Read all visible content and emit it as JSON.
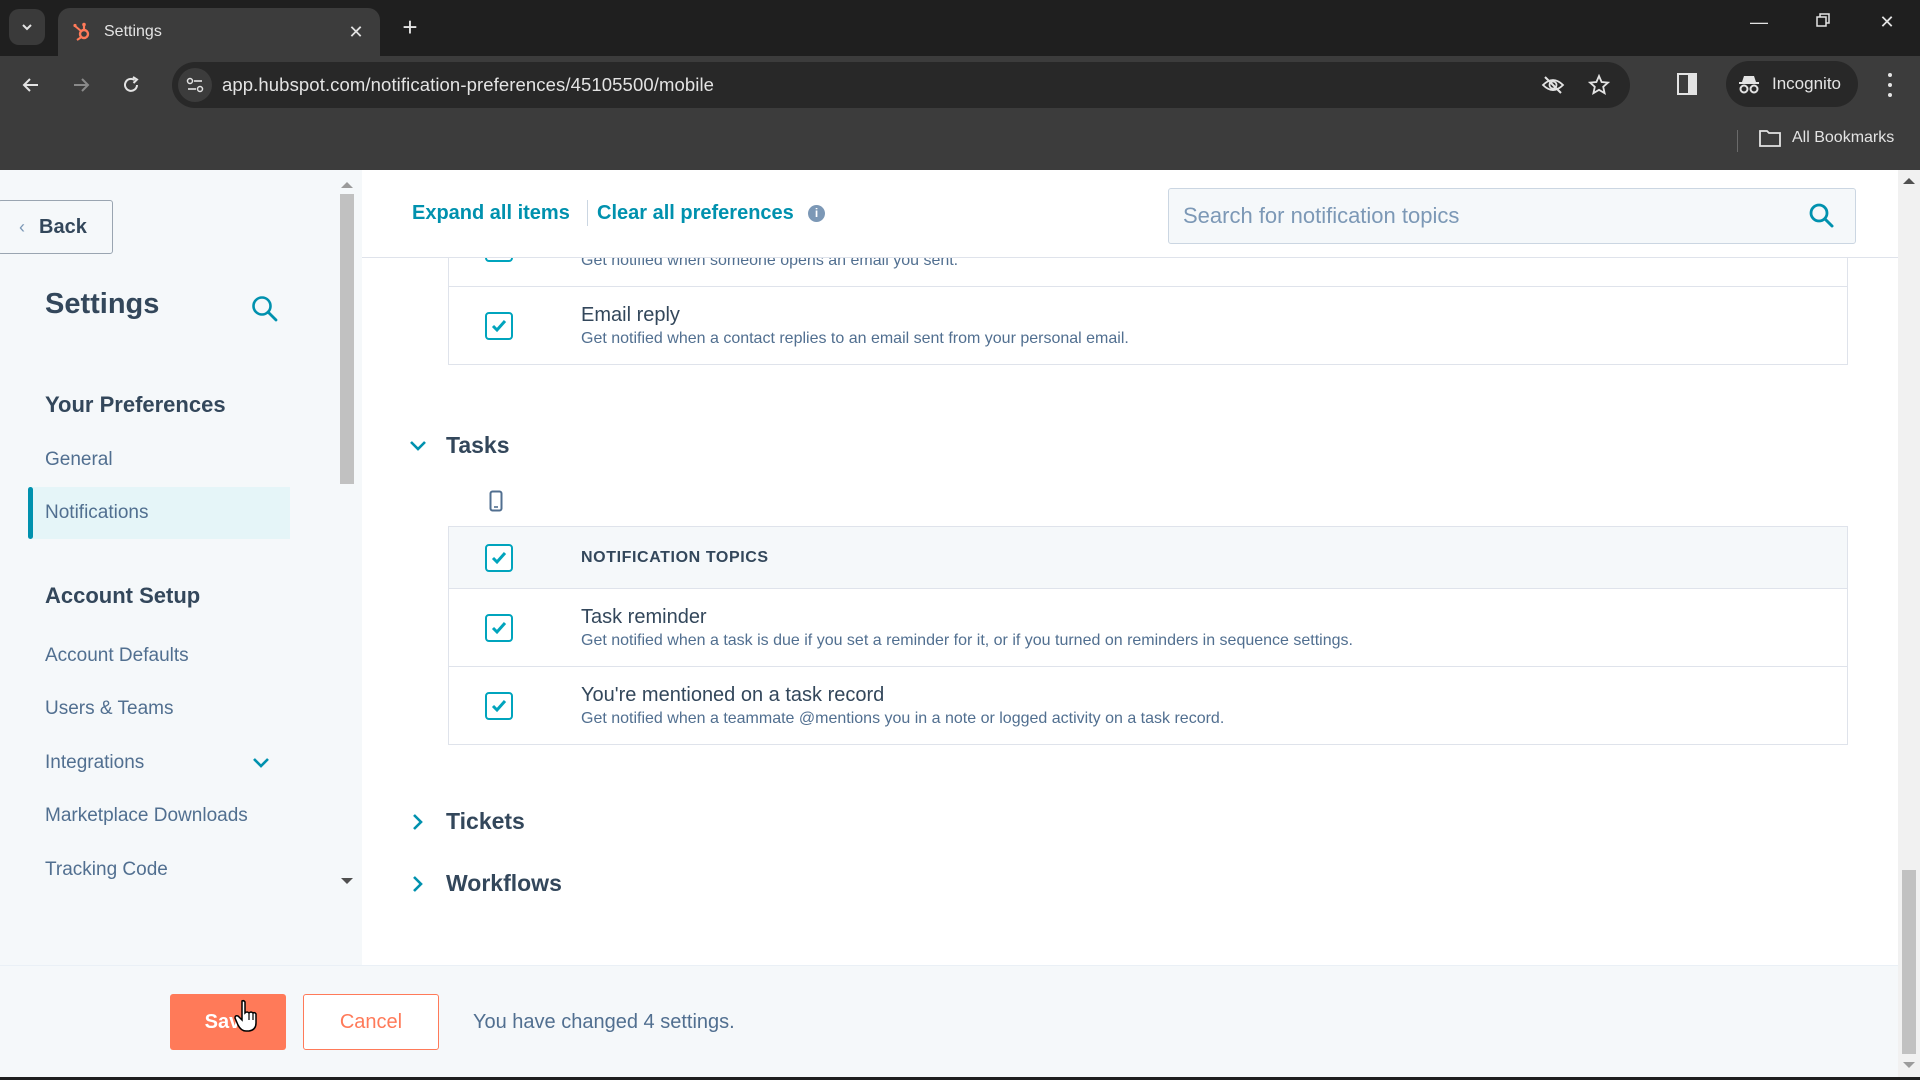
{
  "browser": {
    "tab": {
      "title": "Settings",
      "favicon": "hubspot-sprocket-icon"
    },
    "url": "app.hubspot.com/notification-preferences/45105500/mobile",
    "profile_label": "Incognito",
    "bookmarks_label": "All Bookmarks",
    "icons": [
      "tab-search-icon",
      "close-icon",
      "plus-icon",
      "minimize-icon",
      "restore-icon",
      "window-close-icon",
      "back-arrow-icon",
      "forward-arrow-icon",
      "reload-icon",
      "site-info-icon",
      "eye-off-icon",
      "star-icon",
      "side-panel-icon",
      "incognito-icon",
      "more-vert-icon",
      "folder-icon"
    ]
  },
  "sidebar": {
    "back_label": "Back",
    "title": "Settings",
    "sections": [
      {
        "heading": "Your Preferences",
        "items": [
          {
            "label": "General",
            "active": false
          },
          {
            "label": "Notifications",
            "active": true
          }
        ]
      },
      {
        "heading": "Account Setup",
        "items": [
          {
            "label": "Account Defaults",
            "active": false
          },
          {
            "label": "Users & Teams",
            "active": false
          },
          {
            "label": "Integrations",
            "active": false,
            "expandable": true
          },
          {
            "label": "Marketplace Downloads",
            "active": false
          },
          {
            "label": "Tracking Code",
            "active": false
          }
        ]
      }
    ]
  },
  "main": {
    "expand_all_label": "Expand all items",
    "clear_all_label": "Clear all preferences",
    "search": {
      "placeholder": "Search for notification topics",
      "value": ""
    },
    "email_section": {
      "rows": [
        {
          "title": "",
          "description": "Get notified when someone opens an email you sent.",
          "checked": true
        },
        {
          "title": "Email reply",
          "description": "Get notified when a contact replies to an email sent from your personal email.",
          "checked": true
        }
      ]
    },
    "tasks_section": {
      "title": "Tasks",
      "expanded": true,
      "channel_icon": "mobile-phone-icon",
      "header_label": "NOTIFICATION TOPICS",
      "header_checked": true,
      "rows": [
        {
          "title": "Task reminder",
          "description": "Get notified when a task is due if you set a reminder for it, or if you turned on reminders in sequence settings.",
          "checked": true
        },
        {
          "title": "You're mentioned on a task record",
          "description": "Get notified when a teammate @mentions you in a note or logged activity on a task record.",
          "checked": true
        }
      ]
    },
    "collapsed_sections": [
      {
        "title": "Tickets",
        "expanded": false
      },
      {
        "title": "Workflows",
        "expanded": false
      }
    ]
  },
  "footer": {
    "save_label": "Save",
    "cancel_label": "Cancel",
    "changed_message": "You have changed 4 settings."
  },
  "colors": {
    "accent_teal": "#0091ae",
    "checkbox_teal": "#00a4bd",
    "primary_orange": "#ff7a59",
    "text_dark": "#33475b",
    "text_muted": "#516f90"
  }
}
